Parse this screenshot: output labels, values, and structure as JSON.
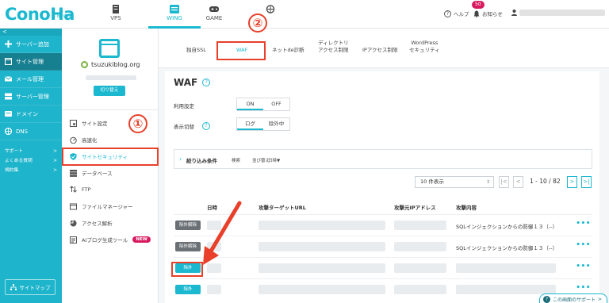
{
  "brand": {
    "logo": "ConoHa",
    "logo_sub": "by GMO"
  },
  "topnav": [
    {
      "label": "VPS",
      "icon": "server-icon"
    },
    {
      "label": "WING",
      "icon": "wing-icon",
      "active": true
    },
    {
      "label": "GAME",
      "icon": "gamepad-icon"
    },
    {
      "label": "",
      "icon": "globe-icon"
    }
  ],
  "topright": {
    "help": "ヘルプ",
    "notice": "お知らせ",
    "notice_count": "50"
  },
  "sidebar": {
    "collapse": "<",
    "items": [
      {
        "label": "サーバー追加",
        "icon": "plus-icon"
      },
      {
        "label": "サイト管理",
        "icon": "site-icon",
        "active": true
      },
      {
        "label": "メール管理",
        "icon": "mail-icon"
      },
      {
        "label": "サーバー管理",
        "icon": "server-icon"
      },
      {
        "label": "ドメイン",
        "icon": "domain-icon"
      },
      {
        "label": "DNS",
        "icon": "dns-icon"
      }
    ],
    "small": [
      {
        "label": "サポート",
        "arrow": ">"
      },
      {
        "label": "よくある質問",
        "arrow": ">"
      },
      {
        "label": "規約集",
        "arrow": ">"
      }
    ],
    "sitemap": "サイトマップ"
  },
  "submenu": {
    "site_name": "tsuzukiblog.org",
    "switch_label": "切り替え",
    "items": [
      {
        "label": "サイト設定",
        "icon": "settings-icon"
      },
      {
        "label": "高速化",
        "icon": "speed-icon"
      },
      {
        "label": "サイトセキュリティ",
        "icon": "shield-icon",
        "active": true
      },
      {
        "label": "データベース",
        "icon": "database-icon"
      },
      {
        "label": "FTP",
        "icon": "ftp-icon"
      },
      {
        "label": "ファイルマネージャー",
        "icon": "folder-icon"
      },
      {
        "label": "アクセス解析",
        "icon": "analytics-icon"
      },
      {
        "label": "AIブログ生成ツール",
        "icon": "ai-icon",
        "badge": "NEW"
      }
    ]
  },
  "tabs": [
    {
      "label": "独自SSL"
    },
    {
      "label": "WAF",
      "active": true
    },
    {
      "label": "ネットde診断"
    },
    {
      "label": "ディレクトリ",
      "label2": "アクセス制限"
    },
    {
      "label": "IPアクセス制限"
    },
    {
      "label": "WordPress",
      "label2": "セキュリティ"
    }
  ],
  "waf": {
    "title": "WAF",
    "setting_label": "利用設定",
    "setting_options": [
      "ON",
      "OFF"
    ],
    "setting_selected": "ON",
    "view_label": "表示切替",
    "view_options": [
      "ログ",
      "除外中"
    ],
    "view_selected": "ログ"
  },
  "filter": {
    "title": "絞り込み条件",
    "search": "検索",
    "sort_label": "並び替え",
    "sort_value": "日時▼"
  },
  "pager": {
    "per_page": "10 件表示",
    "first": "|<",
    "prev": "<",
    "info": "1 - 10 / 82",
    "next": ">",
    "last": ">|"
  },
  "table": {
    "headers": [
      "日時",
      "攻撃ターゲットURL",
      "攻撃元IPアドレス",
      "攻撃内容"
    ],
    "rows": [
      {
        "button": "除外解除",
        "button_style": "dark",
        "content": "SQLインジェクションからの防御１３（--）",
        "more": "•••"
      },
      {
        "button": "除外解除",
        "button_style": "dark",
        "content": "SQLインジェクションからの防御１３（--）",
        "more": "•••"
      },
      {
        "button": "除外",
        "button_style": "teal",
        "content": "",
        "more": "•••"
      },
      {
        "button": "除外",
        "button_style": "teal",
        "content": "",
        "more": "•••"
      }
    ]
  },
  "annotations": {
    "circle1": "①",
    "circle2": "②"
  },
  "support": {
    "label": "この画面のサポート",
    "arrow": ">"
  },
  "colors": {
    "accent": "#1bb8cf",
    "sidebar": "#1eb4cb",
    "highlight": "#e8402a",
    "badge": "#d81b60"
  }
}
